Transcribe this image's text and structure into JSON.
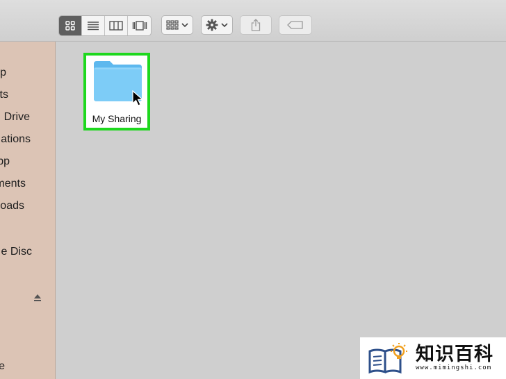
{
  "toolbar": {
    "view_modes": [
      {
        "name": "icon-view",
        "active": true
      },
      {
        "name": "list-view",
        "active": false
      },
      {
        "name": "column-view",
        "active": false
      },
      {
        "name": "gallery-view",
        "active": false
      }
    ],
    "group_button_icon": "grid-icon",
    "action_button_icon": "gear-icon",
    "share_button_icon": "share-icon",
    "tags_button_icon": "tag-icon"
  },
  "sidebar": {
    "items": [
      {
        "label": "p"
      },
      {
        "label": "ts"
      },
      {
        "label": " Drive"
      },
      {
        "label": "ations"
      },
      {
        "label": "pp"
      },
      {
        "label": "ments"
      },
      {
        "label": "oads"
      },
      {
        "label": "e Disc"
      },
      {
        "label": "e"
      }
    ],
    "eject_icon": "eject-icon"
  },
  "main": {
    "selected_item": {
      "label": "My Sharing",
      "icon": "folder-icon",
      "highlight_color": "#1ed81e"
    }
  },
  "watermark": {
    "title": "知识百科",
    "url": "www.mimingshi.com"
  },
  "colors": {
    "sidebar_bg": "#dcc4b5",
    "main_bg": "#cfcfcf",
    "folder_blue": "#6cc4f4",
    "highlight_green": "#1ed81e"
  }
}
